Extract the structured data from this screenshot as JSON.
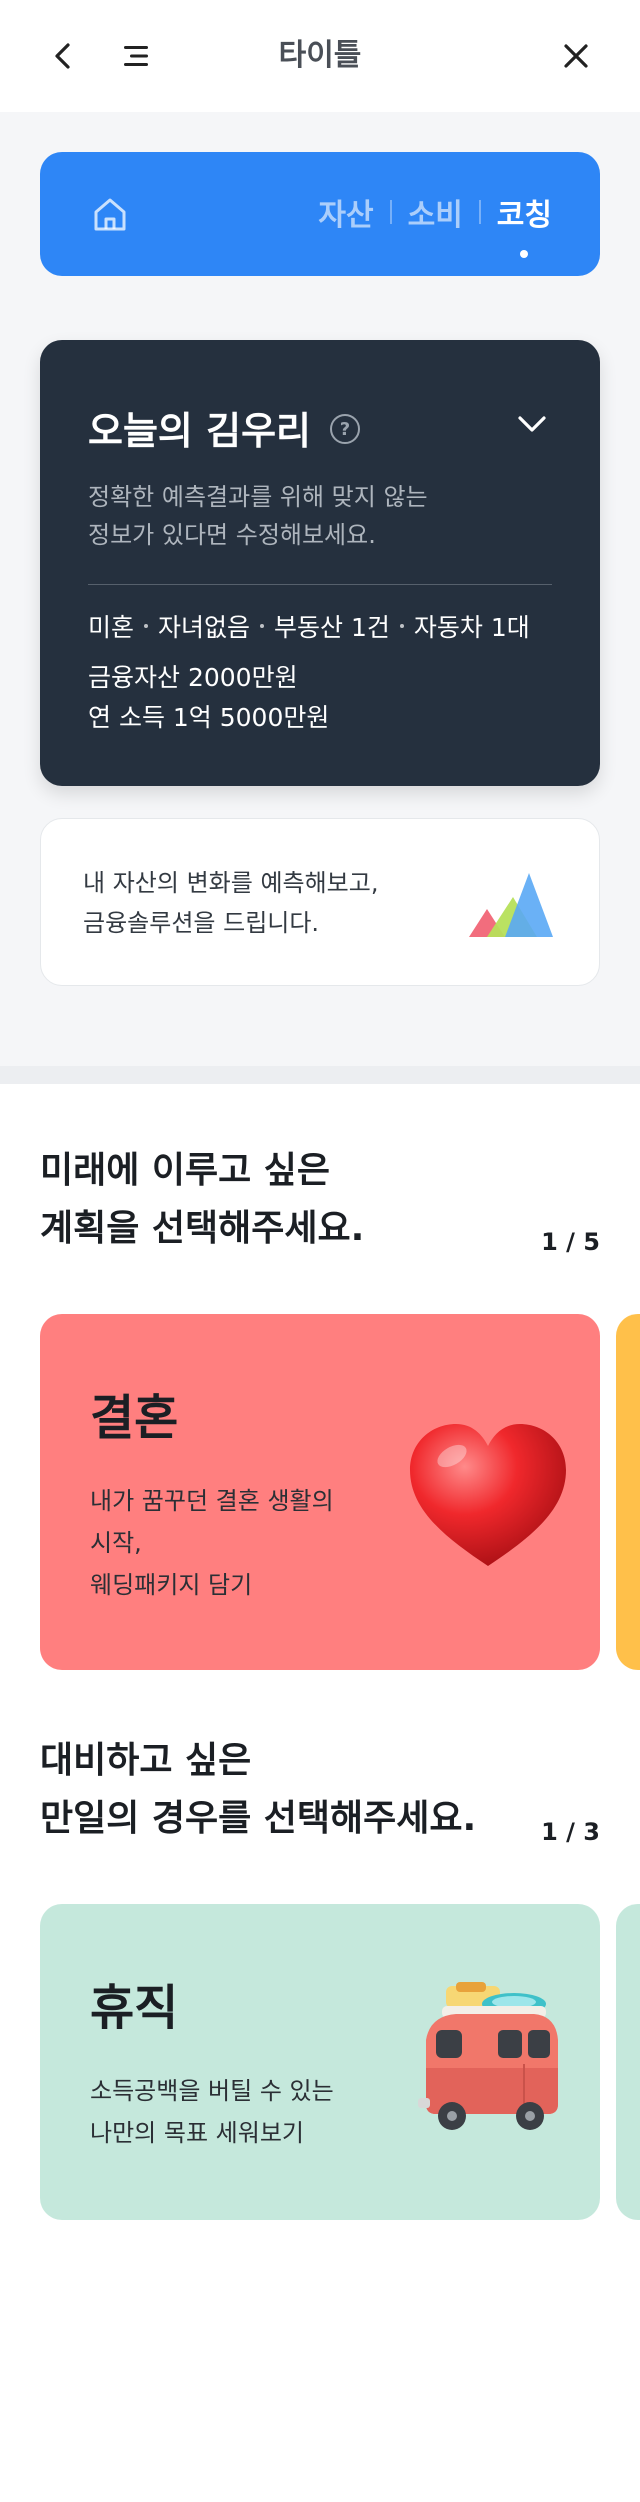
{
  "header": {
    "title": "타이틀"
  },
  "nav": {
    "tabs": [
      {
        "label": "자산",
        "active": false
      },
      {
        "label": "소비",
        "active": false
      },
      {
        "label": "코칭",
        "active": true
      }
    ]
  },
  "profile": {
    "title": "오늘의 김우리",
    "help_icon": "?",
    "description": "정확한 예측결과를 위해 맞지 않는\n정보가 있다면 수정해보세요.",
    "tags": [
      "미혼",
      "자녀없음",
      "부동산 1건",
      "자동차 1대"
    ],
    "financial_assets": "금융자산 2000만원",
    "annual_income": "연 소득 1억 5000만원"
  },
  "info_card": {
    "text": "내 자산의 변화를 예측해보고,\n금융솔루션을 드립니다."
  },
  "plans_section": {
    "title": "미래에 이루고 싶은\n계획을 선택해주세요.",
    "counter": "1 / 5",
    "card": {
      "title": "결혼",
      "description": "내가 꿈꾸던 결혼 생활의\n시작,\n웨딩패키지 담기",
      "background": "#ff7f7f",
      "icon": "heart-icon"
    },
    "next_card_color": "#ffc04a"
  },
  "risk_section": {
    "title": "대비하고 싶은\n만일의 경우를 선택해주세요.",
    "counter": "1 / 3",
    "card": {
      "title": "휴직",
      "description": "소득공백을 버틸 수 있는\n나만의 목표 세워보기",
      "background": "#c5e8dc",
      "icon": "van-icon"
    },
    "next_card_color": "#c5e8dc"
  },
  "colors": {
    "accent": "#2e86f6",
    "dark_card": "#25303e"
  }
}
